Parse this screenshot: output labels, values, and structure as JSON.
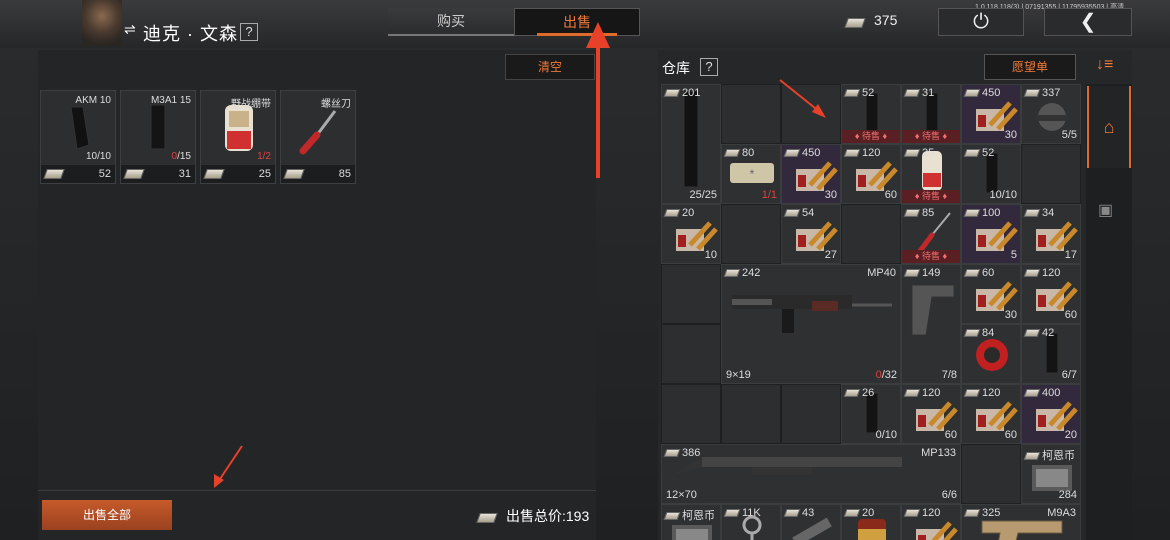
{
  "header": {
    "char_name": "迪克 · 文森",
    "swap_icon": "⇌",
    "help": "?",
    "tab_buy": "购买",
    "tab_sell": "出售",
    "money": "375",
    "version": "1.0.118.118(3) | 07191355 | 11795935503 | 高清",
    "power_icon": "⏻",
    "back_icon": "❮"
  },
  "sell": {
    "clear_label": "清空",
    "items": [
      {
        "name": "AKM 10",
        "count": "10/10",
        "count_red": "",
        "price": "52"
      },
      {
        "name": "M3A1 15",
        "count": "/15",
        "count_red": "0",
        "price": "31"
      },
      {
        "name": "野战绷带",
        "count": "",
        "count_red": "1/2",
        "price": "25"
      },
      {
        "name": "螺丝刀",
        "count": "",
        "count_red": "",
        "price": "85"
      }
    ],
    "sell_all_label": "出售全部",
    "total_label": "出售总价:193"
  },
  "warehouse": {
    "title": "仓库",
    "help": "?",
    "wishlist_label": "愿望单",
    "sort_icon": "↓≡",
    "pending_label": "♦ 待售 ♦",
    "items": [
      {
        "id": "w1",
        "value": "201",
        "count": "25/25"
      },
      {
        "id": "w2",
        "value": "52",
        "pending": true
      },
      {
        "id": "w3",
        "value": "31",
        "pending": true
      },
      {
        "id": "w4",
        "value": "450",
        "count": "30"
      },
      {
        "id": "w5",
        "value": "337",
        "count": "5/5"
      },
      {
        "id": "w6",
        "value": "80",
        "count_red": "1/1"
      },
      {
        "id": "w7",
        "value": "450",
        "count": "30"
      },
      {
        "id": "w8",
        "value": "120",
        "count": "60"
      },
      {
        "id": "w9",
        "value": "25",
        "pending": true
      },
      {
        "id": "w10",
        "value": "52",
        "count": "10/10"
      },
      {
        "id": "w11",
        "value": "20",
        "count": "10"
      },
      {
        "id": "w12",
        "value": "54",
        "count": "27"
      },
      {
        "id": "w13",
        "value": "85",
        "pending": true
      },
      {
        "id": "w14",
        "value": "100",
        "count": "5"
      },
      {
        "id": "w15",
        "value": "34",
        "count": "17"
      },
      {
        "id": "w16",
        "value": "242",
        "name": "MP40",
        "caliber": "9×19",
        "count": "/32",
        "count_red": "0"
      },
      {
        "id": "w17",
        "value": "149",
        "count": "7/8"
      },
      {
        "id": "w18",
        "value": "60",
        "count": "30"
      },
      {
        "id": "w19",
        "value": "120",
        "count": "60"
      },
      {
        "id": "w20",
        "value": "84"
      },
      {
        "id": "w21",
        "value": "42",
        "count": "6/7"
      },
      {
        "id": "w22",
        "value": "26",
        "count": "0/10"
      },
      {
        "id": "w23",
        "value": "120",
        "count": "60"
      },
      {
        "id": "w24",
        "value": "120",
        "count": "60"
      },
      {
        "id": "w25",
        "value": "400",
        "count": "20"
      },
      {
        "id": "w26",
        "value": "386",
        "name": "MP133",
        "caliber": "12×70",
        "count": "6/6"
      },
      {
        "id": "w27",
        "value": "柯恩币",
        "count": "284"
      },
      {
        "id": "w28",
        "value": "柯恩币"
      },
      {
        "id": "w29",
        "value": "11K"
      },
      {
        "id": "w30",
        "value": "43"
      },
      {
        "id": "w31",
        "value": "20"
      },
      {
        "id": "w32",
        "value": "120"
      },
      {
        "id": "w33",
        "value": "325",
        "name": "M9A3"
      }
    ]
  },
  "sidebar": {
    "home_icon": "⌂",
    "box_icon": "▣"
  },
  "colors": {
    "accent": "#e0692c",
    "pending_bg": "#5a1f23",
    "red": "#e04040",
    "arrow": "#e8412a"
  }
}
